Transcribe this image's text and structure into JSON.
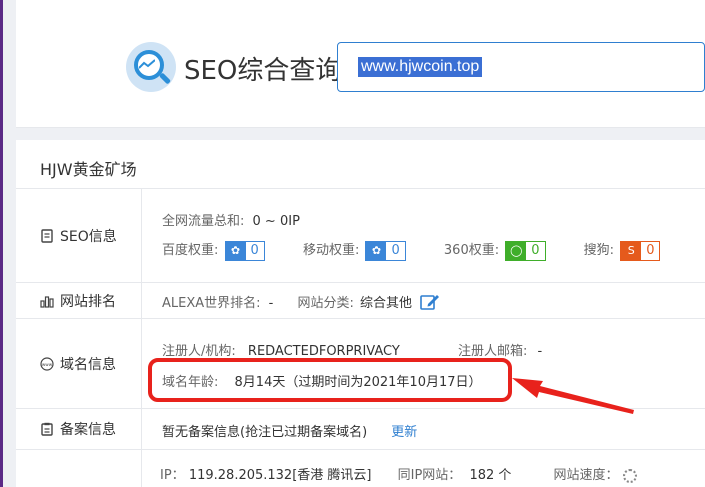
{
  "app_title": "SEO综合查询",
  "search": {
    "value": "www.hjwcoin.top"
  },
  "site_name": "HJW黄金矿场",
  "seo": {
    "label": "SEO信息",
    "traffic_label": "全网流量总和:",
    "traffic_value": "0 ~ 0IP",
    "baidu_label": "百度权重:",
    "baidu_value": "0",
    "mobile_label": "移动权重:",
    "mobile_value": "0",
    "s360_label": "360权重:",
    "s360_value": "0",
    "sogou_label": "搜狗:",
    "sogou_value": "0"
  },
  "rank": {
    "label": "网站排名",
    "alexa_label": "ALEXA世界排名:",
    "alexa_value": "-",
    "category_label": "网站分类:",
    "category_value": "综合其他"
  },
  "domain": {
    "label": "域名信息",
    "registrant_label": "注册人/机构:",
    "registrant_value": "REDACTEDFORPRIVACY",
    "email_label": "注册人邮箱:",
    "email_value": "-",
    "age_label": "域名年龄:",
    "age_value": "8月14天（过期时间为2021年10月17日）"
  },
  "beian": {
    "label": "备案信息",
    "status": "暂无备案信息(抢注已过期备案域名)",
    "update_link": "更新"
  },
  "ip": {
    "ip_label": "IP：",
    "ip_value": "119.28.205.132[香港 腾讯云]",
    "same_ip_label": "同IP网站：",
    "same_ip_value": "182 个",
    "speed_label": "网站速度："
  },
  "colors": {
    "accent": "#2f7fd0",
    "highlight": "#e8221c",
    "baidu_icon": "#3b86d8",
    "s360_icon": "#3fae2a",
    "sogou_icon": "#e55a1c"
  }
}
